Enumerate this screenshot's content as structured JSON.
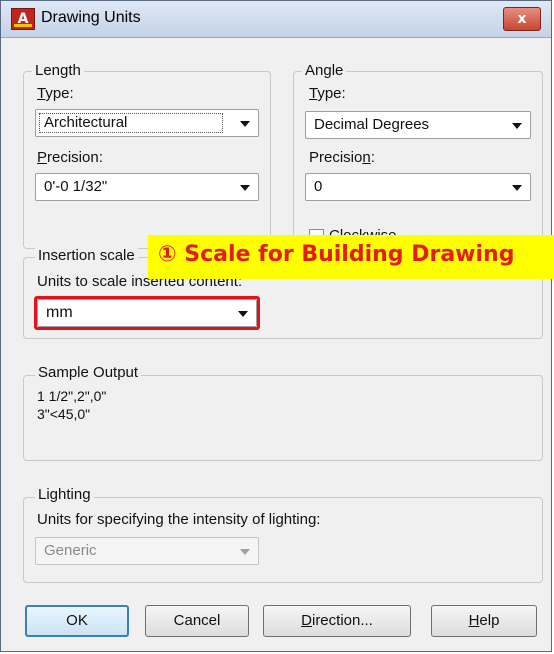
{
  "title": "Drawing Units",
  "close_label": "x",
  "length": {
    "legend": "Length",
    "type_label": "Type:",
    "type_value": "Architectural",
    "precision_label": "Precision:",
    "precision_value": "0'-0 1/32\""
  },
  "angle": {
    "legend": "Angle",
    "type_label": "Type:",
    "type_value": "Decimal Degrees",
    "precision_label": "Precision:",
    "precision_value": "0",
    "clockwise_label": "Clockwise",
    "clockwise_checked": false
  },
  "insertion": {
    "legend": "Insertion scale",
    "units_label": "Units to scale inserted content:",
    "units_value": "mm"
  },
  "annotation": {
    "text": "① Scale for Building Drawing",
    "background": "#ffff00",
    "text_color": "#e51c1c",
    "frame_color": "#e0141c"
  },
  "sample": {
    "legend": "Sample Output",
    "lines": [
      "1 1/2\",2\",0\"",
      "3\"<45,0\""
    ]
  },
  "lighting": {
    "legend": "Lighting",
    "units_label": "Units for specifying the intensity of lighting:",
    "units_value": "Generic",
    "disabled": true
  },
  "buttons": {
    "ok": "OK",
    "cancel": "Cancel",
    "direction": "Direction...",
    "help": "Help"
  }
}
